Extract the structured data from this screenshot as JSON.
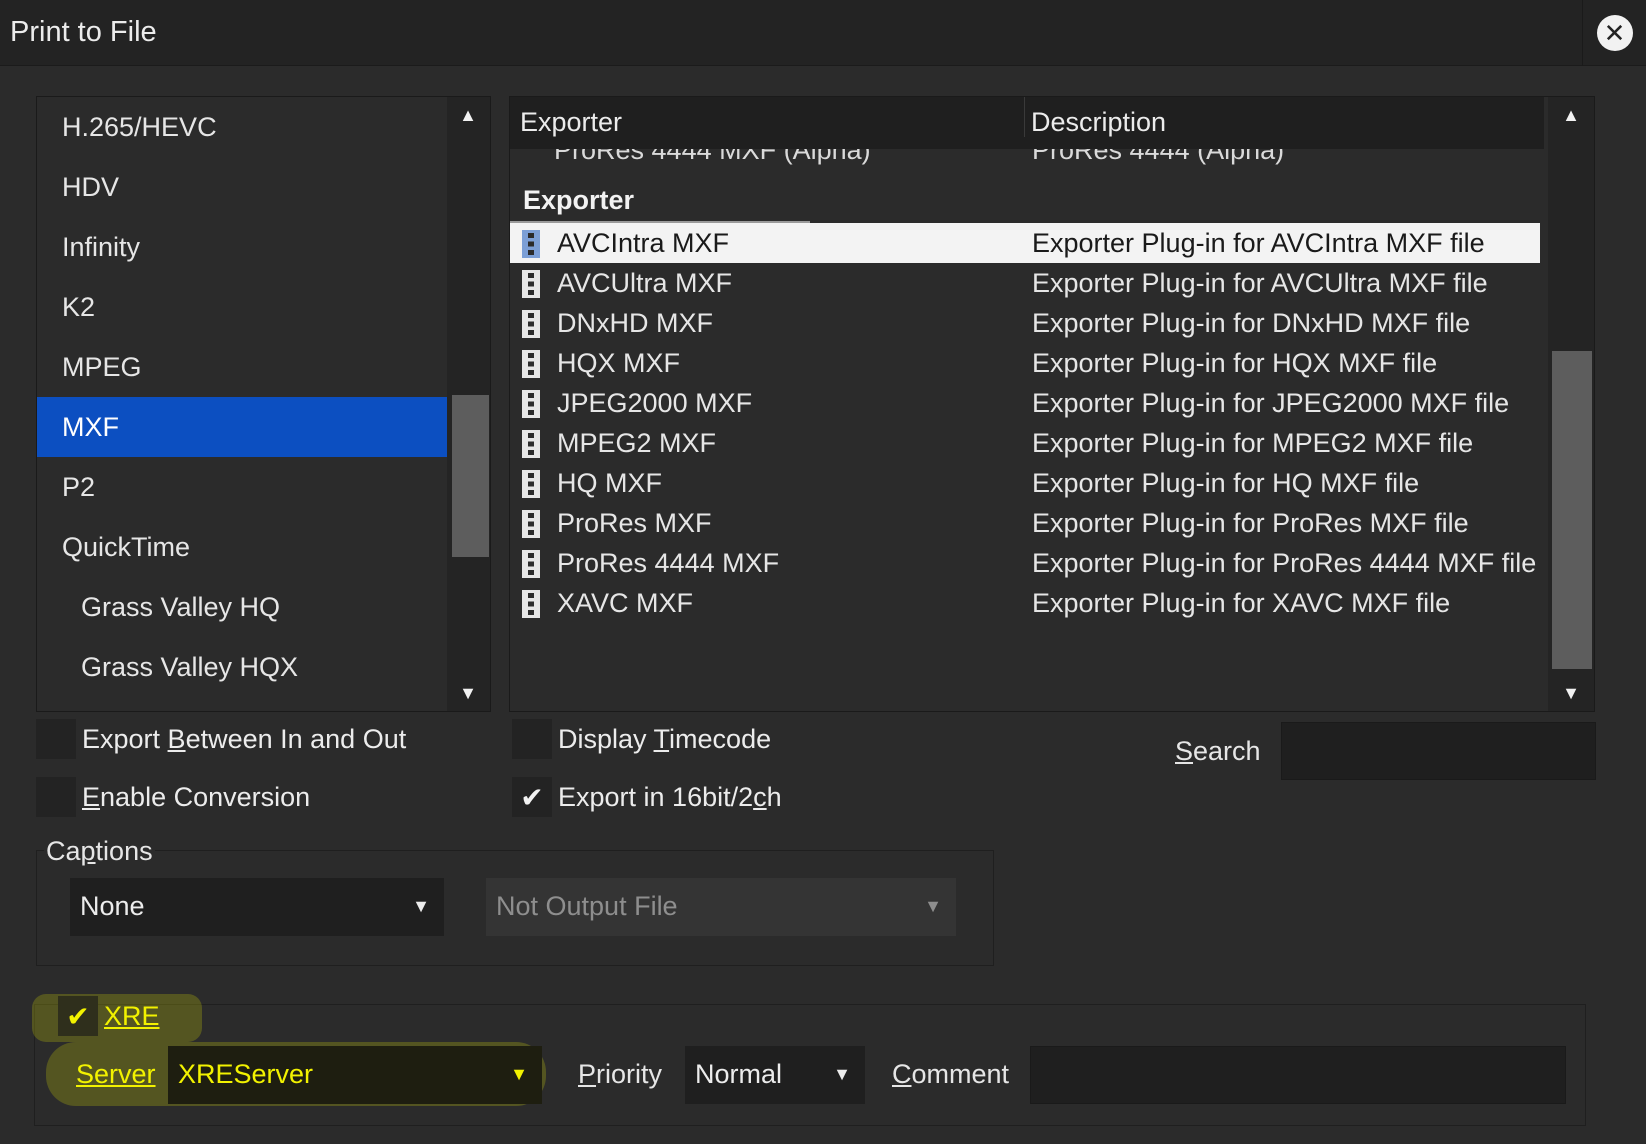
{
  "window": {
    "title": "Print to File",
    "close_icon": "close-circle-icon",
    "close_glyph": "✕"
  },
  "format_list": {
    "items": [
      {
        "label": "H.265/HEVC"
      },
      {
        "label": "HDV"
      },
      {
        "label": "Infinity"
      },
      {
        "label": "K2"
      },
      {
        "label": "MPEG"
      },
      {
        "label": "MXF",
        "selected": true
      },
      {
        "label": "P2"
      },
      {
        "label": "QuickTime"
      },
      {
        "label": "Grass Valley HQ",
        "indent": true
      },
      {
        "label": "Grass Valley HQX",
        "indent": true
      }
    ],
    "scroll_up": "▲",
    "scroll_down": "▼"
  },
  "exporter_table": {
    "columns": [
      "Exporter",
      "Description"
    ],
    "partial_row": {
      "exporter": "ProRes 4444 MXF (Alpha)",
      "description": "ProRes 4444 (Alpha)"
    },
    "group_label": "Exporter",
    "rows": [
      {
        "exporter": "AVCIntra MXF",
        "description": "Exporter Plug-in for AVCIntra MXF file",
        "selected": true
      },
      {
        "exporter": "AVCUltra MXF",
        "description": "Exporter Plug-in for AVCUltra MXF file"
      },
      {
        "exporter": "DNxHD MXF",
        "description": "Exporter Plug-in for DNxHD MXF file"
      },
      {
        "exporter": "HQX MXF",
        "description": "Exporter Plug-in for HQX MXF file"
      },
      {
        "exporter": "JPEG2000 MXF",
        "description": "Exporter Plug-in for JPEG2000 MXF file"
      },
      {
        "exporter": "MPEG2 MXF",
        "description": "Exporter Plug-in for MPEG2 MXF file"
      },
      {
        "exporter": "HQ MXF",
        "description": "Exporter Plug-in for HQ MXF file"
      },
      {
        "exporter": "ProRes MXF",
        "description": "Exporter Plug-in for ProRes MXF file"
      },
      {
        "exporter": "ProRes 4444 MXF",
        "description": "Exporter Plug-in for ProRes 4444 MXF file"
      },
      {
        "exporter": "XAVC MXF",
        "description": "Exporter Plug-in for XAVC MXF file"
      }
    ],
    "scroll_up": "▲",
    "scroll_down": "▼"
  },
  "options": {
    "export_between": {
      "label_pre": "Export ",
      "label_u": "B",
      "label_post": "etween In and Out",
      "checked": false
    },
    "enable_conversion": {
      "label_pre": "",
      "label_u": "E",
      "label_post": "nable Conversion",
      "checked": false
    },
    "display_timecode": {
      "label_pre": "Display ",
      "label_u": "T",
      "label_post": "imecode",
      "checked": false
    },
    "export_16bit": {
      "label_pre": "Export in 16bit/2",
      "label_u": "c",
      "label_post": "h",
      "checked": true
    },
    "check_glyph": "✔"
  },
  "search": {
    "label_u": "S",
    "label_rest": "earch",
    "value": ""
  },
  "captions": {
    "label_pre": "Ca",
    "label_u": "p",
    "label_post": "tions",
    "selected": "None",
    "output": "Not Output File",
    "arrow": "▼"
  },
  "xre": {
    "checked": true,
    "label": "XRE",
    "server_label": "Server",
    "server_value": "XREServer",
    "priority_label_u": "P",
    "priority_label_rest": "riority",
    "priority_value": "Normal",
    "comment_label_u": "C",
    "comment_label_rest": "omment",
    "comment_value": "",
    "highlight_color": "#e6eb00"
  }
}
